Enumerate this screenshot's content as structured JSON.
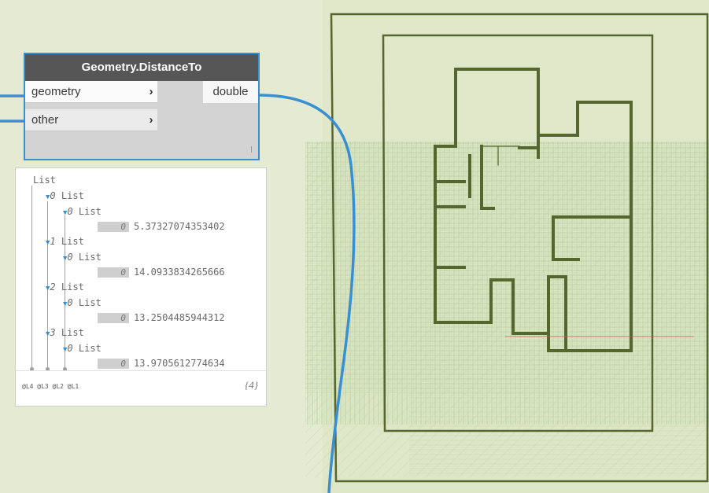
{
  "node": {
    "title": "Geometry.DistanceTo",
    "inputs": [
      {
        "label": "geometry",
        "chevron": "›"
      },
      {
        "label": "other",
        "chevron": "›"
      }
    ],
    "output": "double"
  },
  "preview": {
    "root_label": "List",
    "items": [
      {
        "index": "0",
        "label": "List",
        "sub_index": "0",
        "sub_label": "List",
        "value_index": "0",
        "value": "5.37327074353402"
      },
      {
        "index": "1",
        "label": "List",
        "sub_index": "0",
        "sub_label": "List",
        "value_index": "0",
        "value": "14.0933834265666"
      },
      {
        "index": "2",
        "label": "List",
        "sub_index": "0",
        "sub_label": "List",
        "value_index": "0",
        "value": "13.2504485944312"
      },
      {
        "index": "3",
        "label": "List",
        "sub_index": "0",
        "sub_label": "List",
        "value_index": "0",
        "value": "13.9705612774634"
      }
    ],
    "levels": "@L4 @L3 @L2 @L1",
    "count": "{4}"
  },
  "colors": {
    "background": "#dfe7c9",
    "node_border": "#3a8fd3",
    "node_title_bg": "#565656",
    "wire": "#3a8fd3",
    "geometry": "#55662e",
    "grid": "#b7cf9e"
  },
  "icons": {
    "collapse": "triangle-down-icon",
    "port": "chevron-right-icon"
  }
}
